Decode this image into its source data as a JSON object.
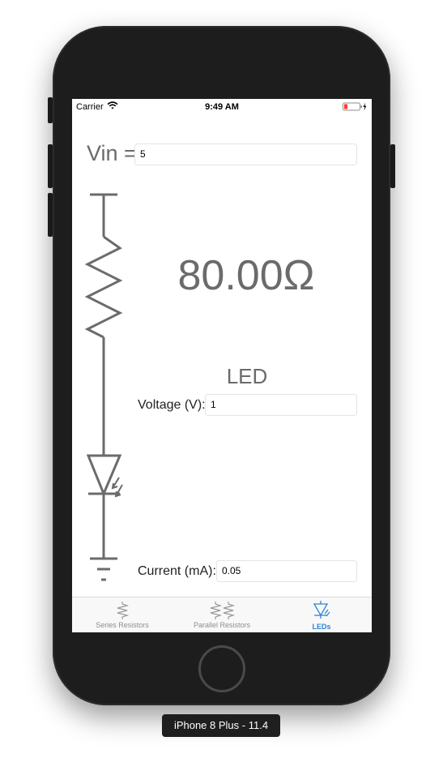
{
  "status_bar": {
    "carrier": "Carrier",
    "time": "9:49 AM"
  },
  "vin": {
    "label": "Vin =",
    "value": "5"
  },
  "result": {
    "resistance": "80.00Ω"
  },
  "led": {
    "title": "LED",
    "voltage_label": "Voltage (V):",
    "voltage_value": "1",
    "current_label": "Current (mA):",
    "current_value": "0.05"
  },
  "tabs": [
    {
      "label": "Series Resistors",
      "icon": "series-resistors-icon",
      "active": false
    },
    {
      "label": "Parallel Resistors",
      "icon": "parallel-resistors-icon",
      "active": false
    },
    {
      "label": "LEDs",
      "icon": "led-icon",
      "active": true
    }
  ],
  "device_caption": "iPhone 8 Plus - 11.4",
  "colors": {
    "accent": "#2f82d6",
    "circuit": "#6b6b6b",
    "device": "#1d1d1d"
  }
}
